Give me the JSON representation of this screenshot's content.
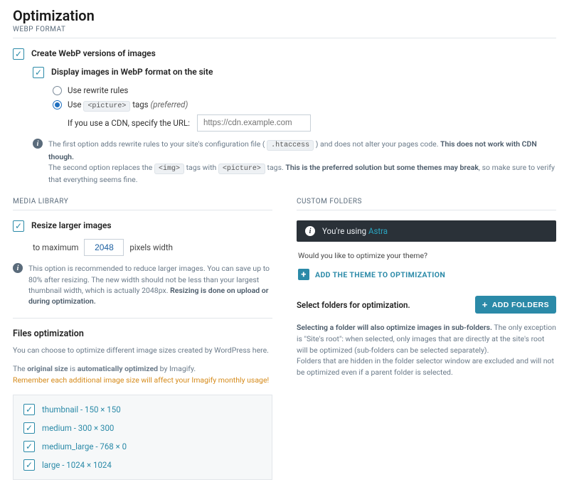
{
  "page": {
    "title": "Optimization"
  },
  "webp": {
    "section_label": "WEBP FORMAT",
    "create_label": "Create WebP versions of images",
    "display_label": "Display images in WebP format on the site",
    "radio_rewrite": "Use rewrite rules",
    "radio_picture_prefix": "Use ",
    "radio_picture_code": "<picture>",
    "radio_picture_suffix": " tags ",
    "radio_picture_preferred": "(preferred)",
    "cdn_label": "If you use a CDN, specify the URL:",
    "cdn_placeholder": "https://cdn.example.com",
    "info": {
      "line1a": "The first option adds rewrite rules to your site's configuration file ( ",
      "htaccess": ".htaccess",
      "line1b": " ) and does not alter your pages code. ",
      "line1_bold": "This does not work with CDN though.",
      "line2a": "The second option replaces the ",
      "img_code": "<img>",
      "line2b": " tags with ",
      "picture_code": "<picture>",
      "line2c": " tags. ",
      "line2_bold": "This is the preferred solution but some themes may break",
      "line2d": ", so make sure to verify that everything seems fine."
    }
  },
  "media": {
    "section_label": "MEDIA LIBRARY",
    "resize_label": "Resize larger images",
    "to_max": "to maximum",
    "max_value": "2048",
    "px_width": "pixels width",
    "info": {
      "a": "This option is recommended to reduce larger images. You can save up to 80% after resizing. The new width should not be less than your largest thumbnail width, which is actually 2048px. ",
      "bold": "Resizing is done on upload or during optimization."
    }
  },
  "files": {
    "title": "Files optimization",
    "desc": "You can choose to optimize different image sizes created by WordPress here.",
    "line_a": "The ",
    "line_b_bold": "original size",
    "line_c": " is ",
    "line_d_bold": "automatically optimized",
    "line_e": " by Imagify.",
    "warn": "Remember each additional image size will affect your Imagify monthly usage!",
    "sizes": [
      "thumbnail - 150 × 150",
      "medium - 300 × 300",
      "medium_large - 768 × 0",
      "large - 1024 × 1024"
    ]
  },
  "custom": {
    "section_label": "CUSTOM FOLDERS",
    "banner_prefix": "You're using ",
    "banner_theme": "Astra",
    "question": "Would you like to optimize your theme?",
    "add_theme": "ADD THE THEME TO OPTIMIZATION",
    "select_label": "Select folders for optimization.",
    "add_folders_btn": "ADD FOLDERS",
    "desc_bold": "Selecting a folder will also optimize images in sub-folders.",
    "desc_rest": " The only exception is \"Site's root\": when selected, only images that are directly at the site's root will be optimized (sub-folders can be selected separately).",
    "desc_hidden": "Folders that are hidden in the folder selector window are excluded and will not be optimized even if a parent folder is selected."
  }
}
